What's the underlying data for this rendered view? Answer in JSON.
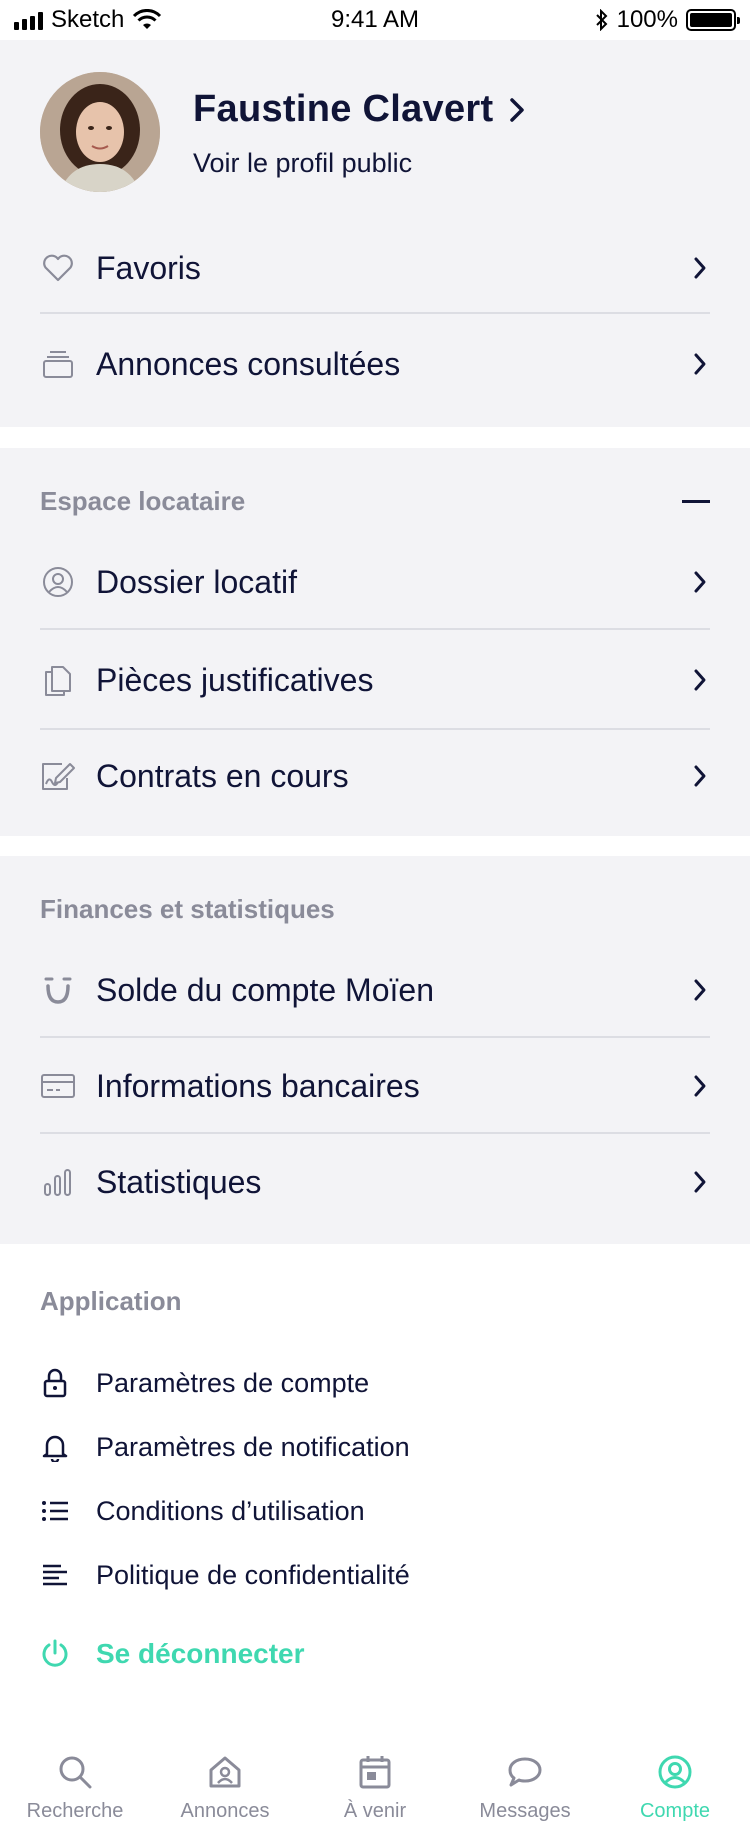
{
  "status_bar": {
    "carrier": "Sketch",
    "time": "9:41 AM",
    "battery": "100%"
  },
  "profile": {
    "name": "Faustine Clavert",
    "subtitle": "Voir le profil public"
  },
  "top_items": [
    {
      "label": "Favoris",
      "icon": "heart-icon"
    },
    {
      "label": "Annonces consultées",
      "icon": "stack-icon"
    }
  ],
  "tenant": {
    "title": "Espace locataire",
    "items": [
      {
        "label": "Dossier locatif",
        "icon": "user-circle-icon"
      },
      {
        "label": "Pièces justificatives",
        "icon": "documents-icon"
      },
      {
        "label": "Contrats en cours",
        "icon": "contract-icon"
      }
    ]
  },
  "finance": {
    "title": "Finances et statistiques",
    "items": [
      {
        "label": "Solde du compte Moïen",
        "icon": "moien-logo-icon"
      },
      {
        "label": "Informations bancaires",
        "icon": "credit-card-icon"
      },
      {
        "label": "Statistiques",
        "icon": "bar-chart-icon"
      }
    ]
  },
  "application": {
    "title": "Application",
    "items": [
      {
        "label": "Paramètres de compte",
        "icon": "lock-icon"
      },
      {
        "label": "Paramètres de notification",
        "icon": "bell-icon"
      },
      {
        "label": "Conditions d’utilisation",
        "icon": "list-icon"
      },
      {
        "label": "Politique de confidentialité",
        "icon": "text-lines-icon"
      }
    ],
    "logout": "Se déconnecter"
  },
  "tabs": [
    {
      "label": "Recherche",
      "icon": "search-icon",
      "active": false
    },
    {
      "label": "Annonces",
      "icon": "house-icon",
      "active": false
    },
    {
      "label": "À venir",
      "icon": "calendar-icon",
      "active": false
    },
    {
      "label": "Messages",
      "icon": "chat-icon",
      "active": false
    },
    {
      "label": "Compte",
      "icon": "account-icon",
      "active": true
    }
  ],
  "colors": {
    "accent": "#3fd8b0",
    "text": "#101437",
    "muted": "#8a8b99",
    "section_bg": "#f3f3f6"
  }
}
